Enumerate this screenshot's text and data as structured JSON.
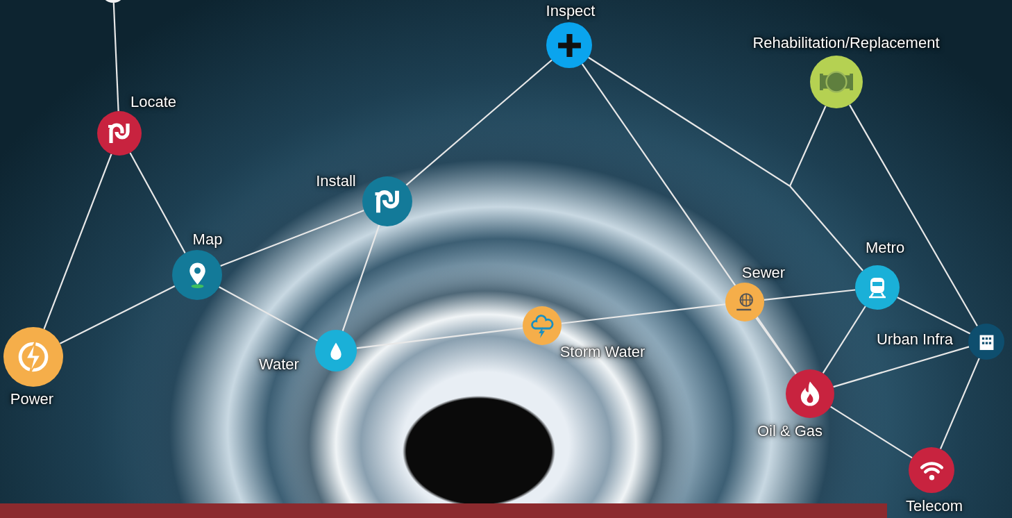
{
  "nodes": [
    {
      "label": "Locate",
      "color": "#c8233f"
    },
    {
      "label": "Inspect",
      "color": "#0aa4ee"
    },
    {
      "label": "Rehabilitation/Replacement",
      "color": "#b5d152"
    },
    {
      "label": "Install",
      "color": "#137a99"
    },
    {
      "label": "Map",
      "color": "#137a99"
    },
    {
      "label": "Power",
      "color": "#f5ae4a"
    },
    {
      "label": "Water",
      "color": "#1ab0d8"
    },
    {
      "label": "Storm Water",
      "color": "#f5ae4a"
    },
    {
      "label": "Sewer",
      "color": "#f5ae4a"
    },
    {
      "label": "Metro",
      "color": "#1ab0d8"
    },
    {
      "label": "Urban Infra",
      "color": "#0e4e6e"
    },
    {
      "label": "Oil & Gas",
      "color": "#c8233f"
    },
    {
      "label": "Telecom",
      "color": "#c8233f"
    }
  ]
}
